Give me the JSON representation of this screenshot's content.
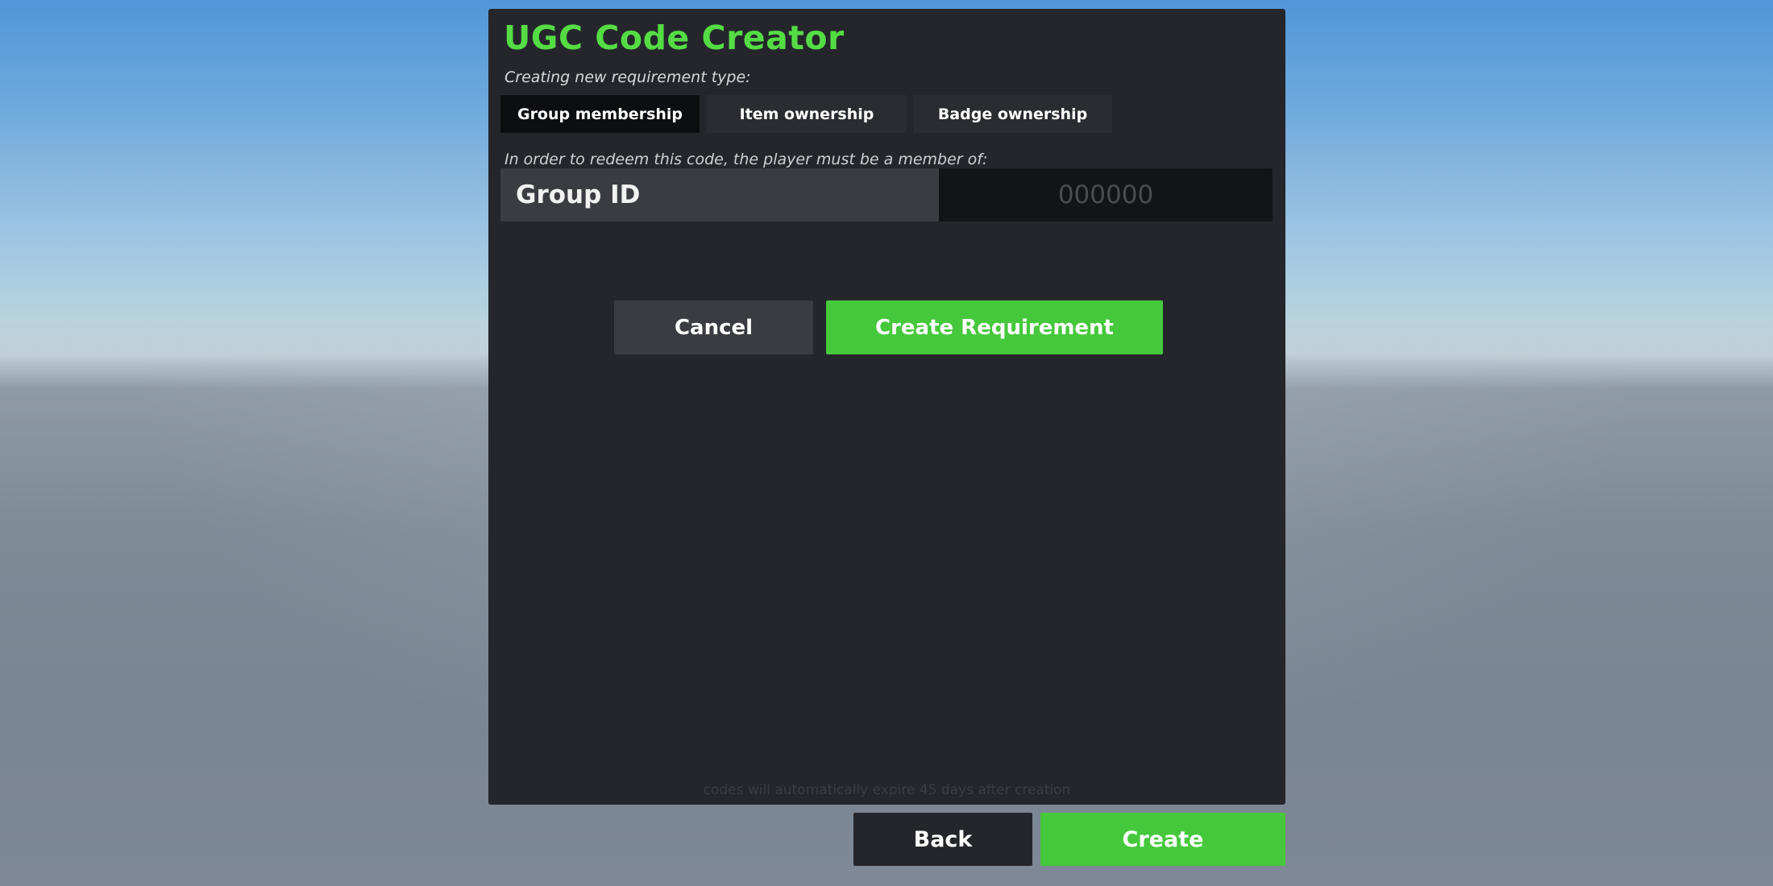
{
  "app": {
    "title": "UGC Code Creator"
  },
  "requirement": {
    "type_prompt": "Creating new requirement type:",
    "tabs": [
      {
        "label": "Group membership",
        "active": true
      },
      {
        "label": "Item ownership",
        "active": false
      },
      {
        "label": "Badge ownership",
        "active": false
      }
    ],
    "description": "In order to redeem this code, the player must be a member of:",
    "field": {
      "label": "Group ID",
      "value": "",
      "placeholder": "000000"
    },
    "cancel_label": "Cancel",
    "create_requirement_label": "Create Requirement"
  },
  "footnote": "codes will automatically expire 45 days after creation",
  "footer": {
    "back_label": "Back",
    "create_label": "Create"
  },
  "colors": {
    "accent_green": "#45c83b",
    "title_green": "#55dc45",
    "panel_bg": "#25262c"
  }
}
